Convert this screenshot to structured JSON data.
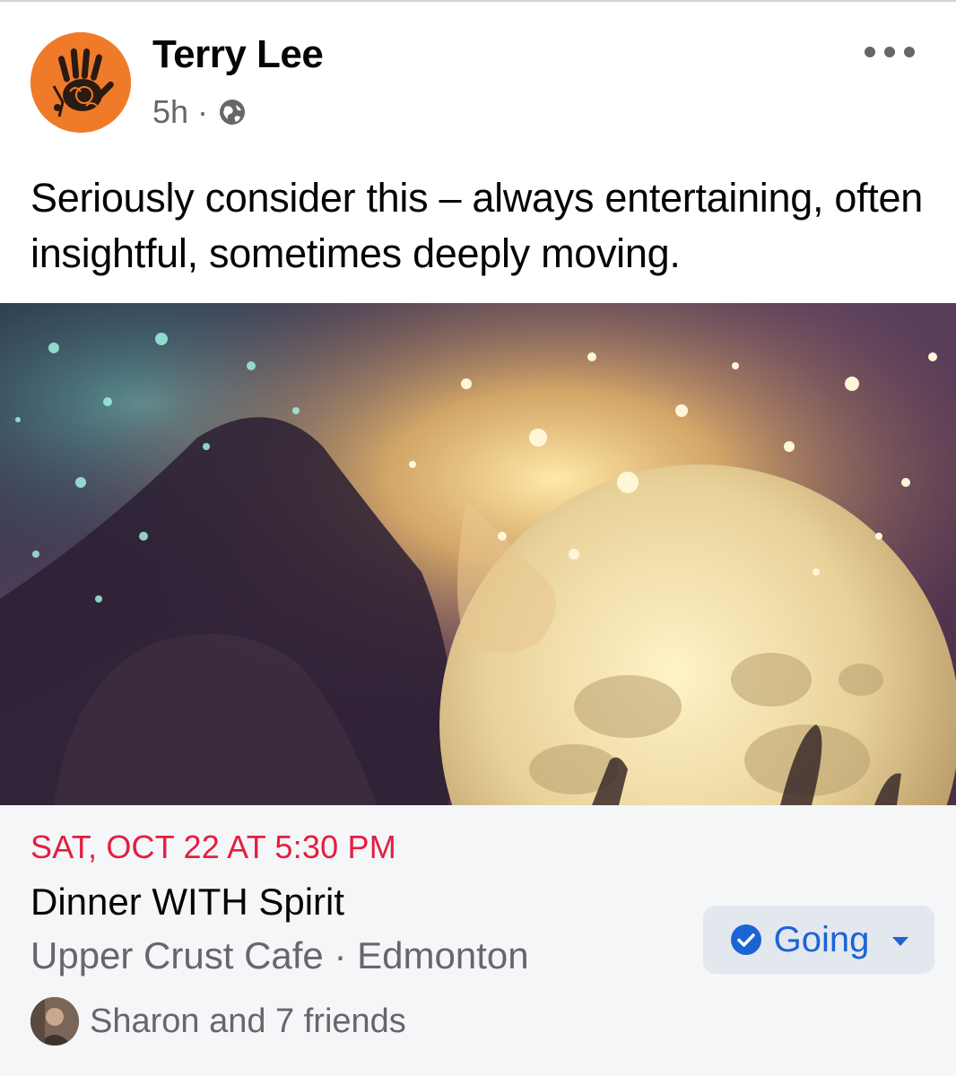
{
  "post": {
    "author_name": "Terry Lee",
    "timestamp": "5h",
    "separator": "·",
    "privacy_icon": "globe-icon",
    "more_icon": "more-dots-icon",
    "text": "Seriously consider this – always entertaining, often insightful, sometimes deeply moving."
  },
  "event": {
    "date": "SAT, OCT 22 AT 5:30 PM",
    "title": "Dinner WITH Spirit",
    "location": "Upper Crust Cafe · Edmonton",
    "friends_text": "Sharon and 7 friends",
    "rsvp_label": "Going",
    "rsvp_icon": "check-circle-icon",
    "rsvp_caret_icon": "caret-down-icon"
  },
  "colors": {
    "event_date": "#e41e3f",
    "rsvp_text": "#1b64d4",
    "avatar_bg": "#ef7b2a",
    "secondary_text": "#65676b"
  }
}
